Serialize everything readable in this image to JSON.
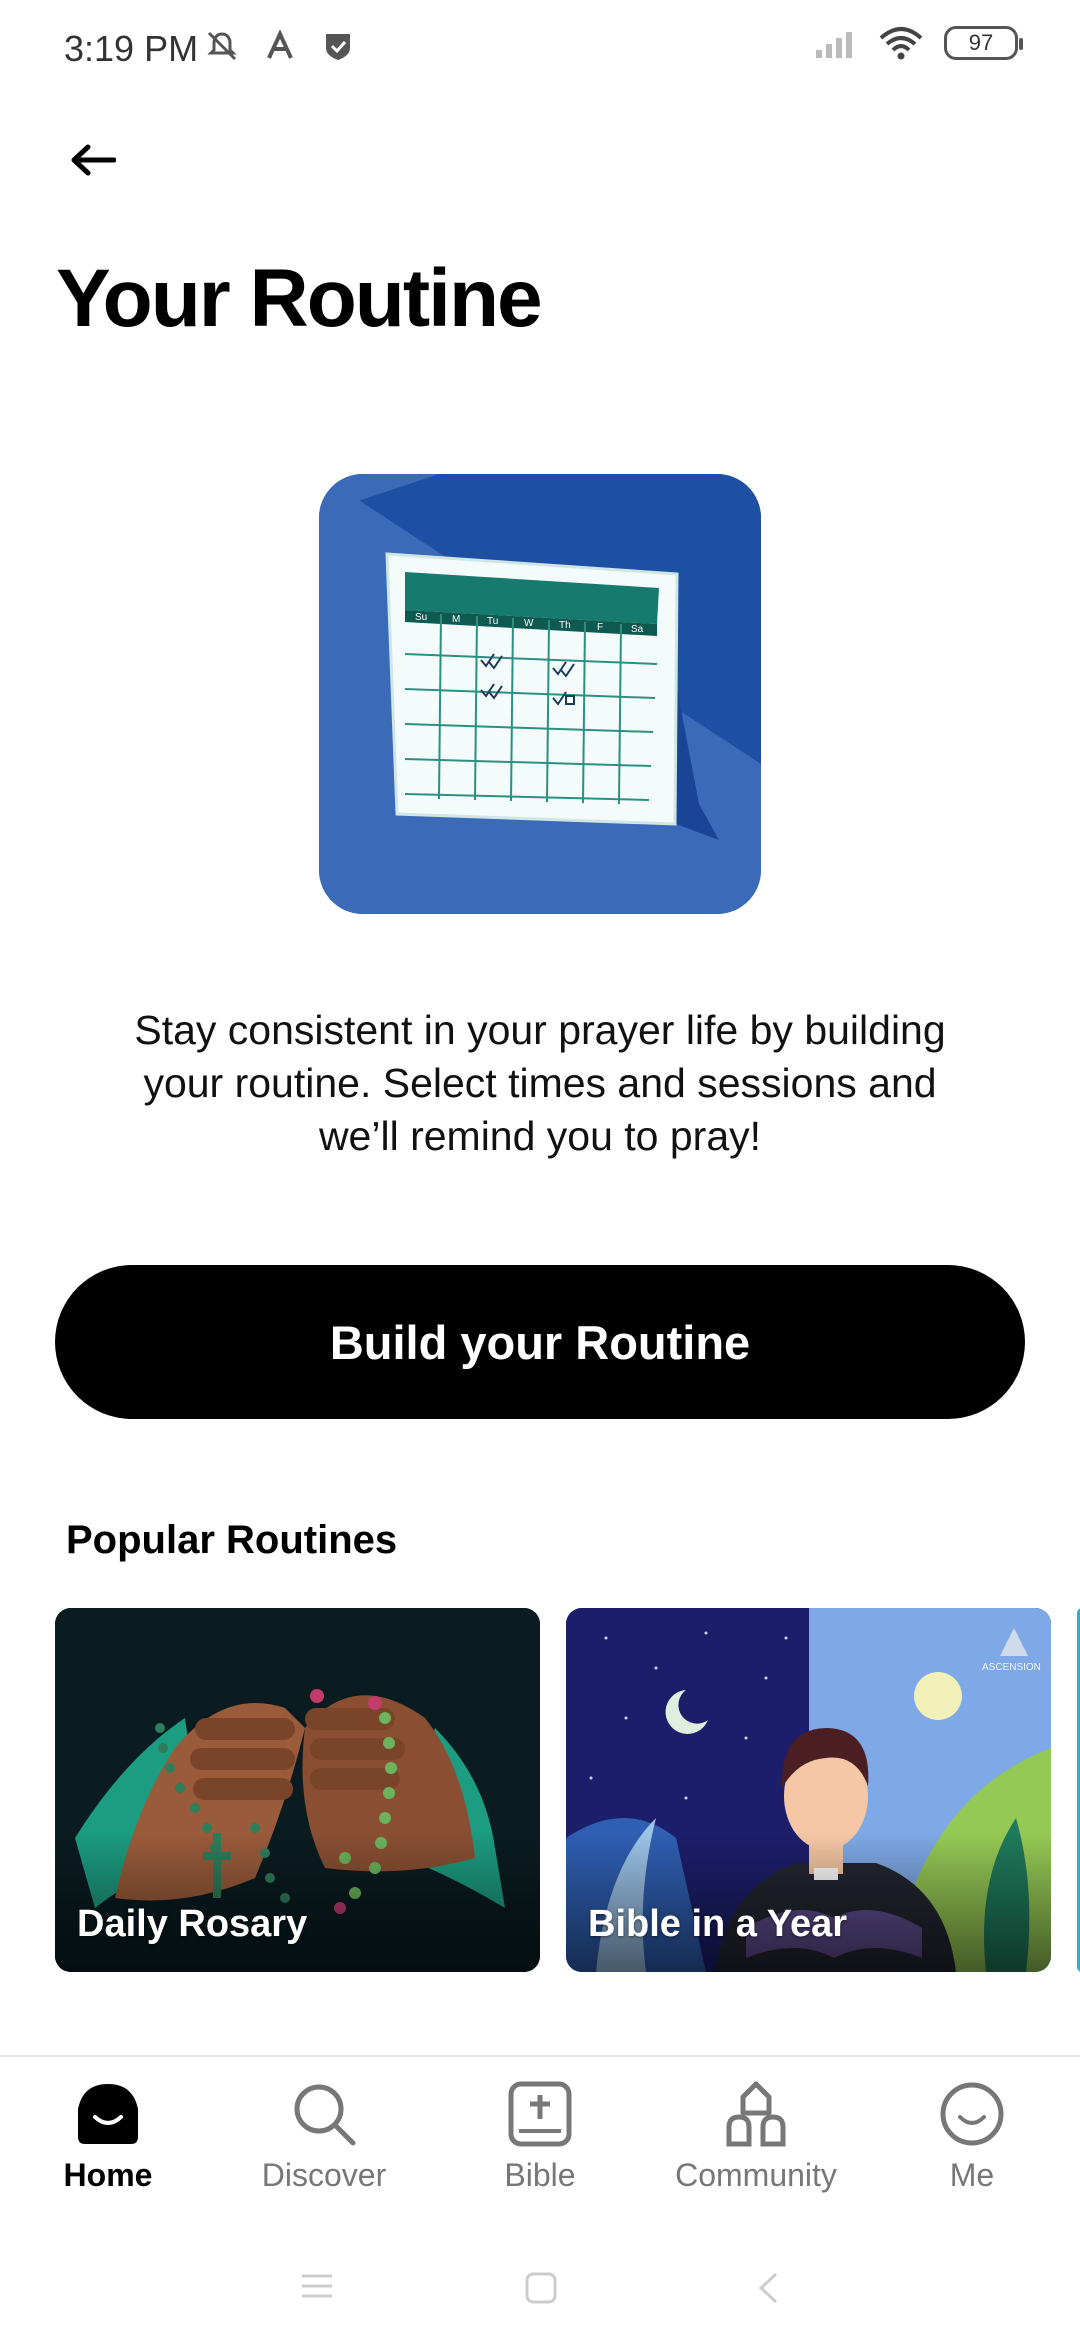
{
  "status_bar": {
    "time": "3:19 PM",
    "battery": "97",
    "icons": [
      "mute-icon",
      "a-icon",
      "shield-icon",
      "signal-icon",
      "wifi-icon"
    ]
  },
  "header": {
    "back_icon": "arrow-left-icon",
    "title": "Your Routine"
  },
  "intro": {
    "illustration": "calendar-illustration",
    "calendar_days": [
      "Su",
      "M",
      "Tu",
      "W",
      "Th",
      "F",
      "Sa"
    ],
    "description": "Stay consistent in your prayer life by building your routine. Select times and sessions and we’ll remind you to pray!"
  },
  "cta": {
    "label": "Build your Routine"
  },
  "popular": {
    "title": "Popular Routines",
    "cards": [
      {
        "label": "Daily Rosary"
      },
      {
        "label": "Bible in a Year",
        "brand": "ASCENSION"
      }
    ]
  },
  "bottom_nav": {
    "items": [
      {
        "label": "Home",
        "icon": "home-smile-icon",
        "active": true
      },
      {
        "label": "Discover",
        "icon": "search-icon",
        "active": false
      },
      {
        "label": "Bible",
        "icon": "bible-icon",
        "active": false
      },
      {
        "label": "Community",
        "icon": "community-icon",
        "active": false
      },
      {
        "label": "Me",
        "icon": "profile-icon",
        "active": false
      }
    ]
  },
  "colors": {
    "illustration_bg": "#3b6ab8",
    "calendar_header": "#167a6e",
    "cta_bg": "#000000",
    "active_nav": "#000000",
    "inactive_nav": "#777777"
  }
}
